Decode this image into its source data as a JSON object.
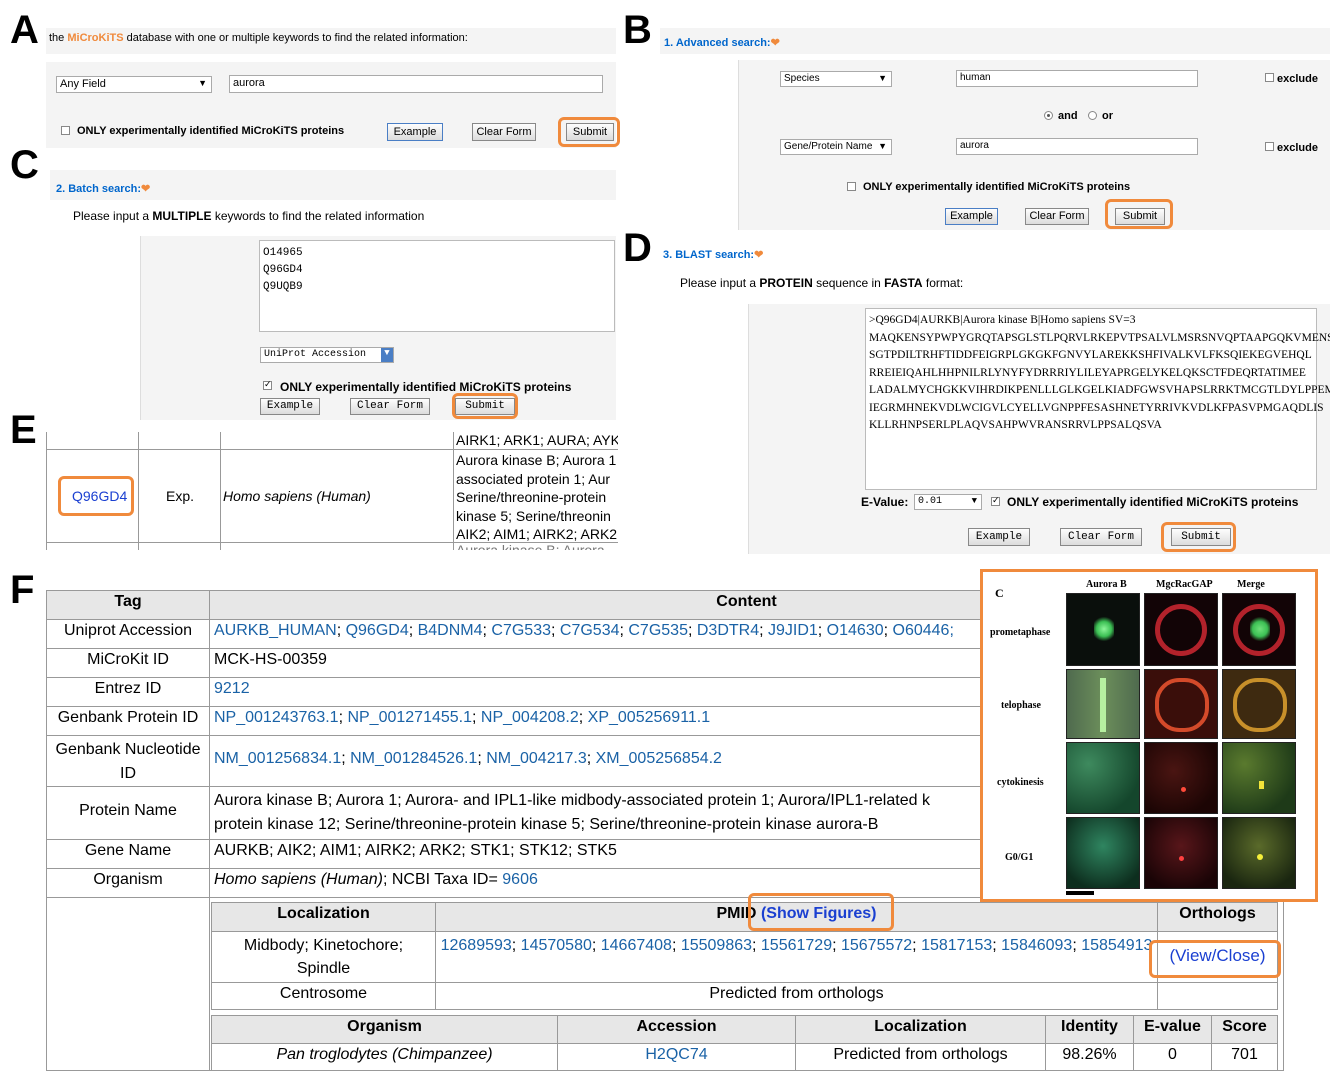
{
  "panel_labels": {
    "a": "A",
    "b": "B",
    "c": "C",
    "d": "D",
    "e": "E",
    "f": "F"
  },
  "A": {
    "intro_pre": "the ",
    "brand_mi": "MiCroKiTS",
    "intro_post": " database with one or multiple keywords to find the related information:",
    "field_select": "Any Field",
    "keyword_value": "aurora",
    "only_label": "ONLY experimentally identified MiCroKiTS proteins",
    "example": "Example",
    "clear": "Clear Form",
    "submit": "Submit"
  },
  "B": {
    "title": "1. Advanced search:",
    "row1_select": "Species",
    "row1_value": "human",
    "row1_exclude": "exclude",
    "and_label": "and",
    "or_label": "or",
    "row2_select": "Gene/Protein Name",
    "row2_value": "aurora",
    "row2_exclude": "exclude",
    "only_label": "ONLY experimentally identified MiCroKiTS proteins",
    "example": "Example",
    "clear": "Clear Form",
    "submit": "Submit"
  },
  "C": {
    "title": "2. Batch search:",
    "instr_pre": "Please input a ",
    "instr_bold": "MULTIPLE",
    "instr_post": " keywords to find the related information",
    "ids": [
      "O14965",
      "Q96GD4",
      "Q9UQB9"
    ],
    "type_select": "UniProt Accession",
    "only_label": "ONLY experimentally identified MiCroKiTS proteins",
    "example": "Example",
    "clear": "Clear Form",
    "submit": "Submit"
  },
  "D": {
    "title": "3. BLAST search:",
    "instr_pre": "Please input a ",
    "instr_bold1": "PROTEIN",
    "instr_mid": " sequence in ",
    "instr_bold2": "FASTA",
    "instr_post": " format:",
    "fasta": [
      ">Q96GD4|AURKB|Aurora kinase B|Homo sapiens SV=3",
      "MAQKENSYPWPYGRQTAPSGLSTLPQRVLRKEPVTPSALVLMSRSNVQPTAAPGQKVMENS",
      "SGTPDILTRHFTIDDFEIGRPLGKGKFGNVYLAREKKSHFIVALKVLFKSQIEKEGVEHQL",
      "RREIEIQAHLHHPNILRLYNYFYDRRRIYLILEYAPRGELYKELQKSCTFDEQRTATIMEE",
      "LADALMYCHGKKVIHRDIKPENLLLGLKGELKIADFGWSVHAPSLRRKTMCGTLDYLPPEM",
      "IEGRMHNEKVDLWCIGVLCYELLVGNPPFESASHNETYRRIVKVDLKFPASVPMGAQDLIS",
      "KLLRHNPSERLPLAQVSAHPWVRANSRRVLPPSALQSVA"
    ],
    "evalue_label": "E-Value:",
    "evalue": "0.01",
    "only_label": "ONLY experimentally identified MiCroKiTS proteins",
    "example": "Example",
    "clear": "Clear Form",
    "submit": "Submit"
  },
  "E": {
    "top_text": "AIRK1; ARK1; AURA; AYK",
    "accession": "Q96GD4",
    "evidence": "Exp.",
    "organism": "Homo sapiens (Human)",
    "names": [
      "Aurora kinase B; Aurora 1",
      "associated protein 1; Aur",
      "Serine/threonine-protein",
      "kinase 5; Serine/threonin",
      "AIK2; AIM1; AIRK2; ARK2"
    ],
    "bottom_text": "Aurora kinase B; Aurora"
  },
  "F": {
    "head_tag": "Tag",
    "head_content": "Content",
    "rows": [
      {
        "tag": "Uniprot Accession",
        "links": [
          "AURKB_HUMAN",
          "Q96GD4",
          "B4DNM4",
          "C7G533",
          "C7G534",
          "C7G535",
          "D3DTR4",
          "J9JID1",
          "O14630",
          "O60446;"
        ]
      },
      {
        "tag": "MiCroKit ID",
        "text": "MCK-HS-00359"
      },
      {
        "tag": "Entrez ID",
        "links": [
          "9212"
        ]
      },
      {
        "tag": "Genbank Protein ID",
        "links": [
          "NP_001243763.1",
          "NP_001271455.1",
          "NP_004208.2",
          "XP_005256911.1"
        ]
      },
      {
        "tag": "Genbank Nucleotide ID",
        "links": [
          "NM_001256834.1",
          "NM_001284526.1",
          "NM_004217.3",
          "XM_005256854.2"
        ]
      },
      {
        "tag": "Protein Name",
        "text": "Aurora kinase B; Aurora 1; Aurora- and IPL1-like midbody-associated protein 1; Aurora/IPL1-related k",
        "text2": "protein kinase 12; Serine/threonine-protein kinase 5; Serine/threonine-protein kinase aurora-B"
      },
      {
        "tag": "Gene Name",
        "text": "AURKB; AIK2; AIM1; AIRK2; ARK2; STK1; STK12; STK5"
      },
      {
        "tag": "Organism",
        "italic": "Homo sapiens (Human)",
        "text": "; NCBI Taxa ID= ",
        "link": "9606"
      }
    ],
    "loc_head": "Localization",
    "pmid_head": "PMID",
    "show_figures": "(Show Figures)",
    "orth_head": "Orthologs",
    "loc1": "Midbody; Kinetochore; Spindle",
    "pmids": [
      "12689593",
      "14570580",
      "14667408",
      "15509863",
      "15561729",
      "15675572",
      "15817153",
      "15846093",
      "15854913"
    ],
    "view_close": "(View/Close)",
    "loc2": "Centrosome",
    "loc2_text": "Predicted from orthologs",
    "orth_cols": [
      "Organism",
      "Accession",
      "Localization",
      "Identity",
      "E-value",
      "Score"
    ],
    "orth_row": [
      "Pan troglodytes (Chimpanzee)",
      "H2QC74",
      "Predicted from orthologs",
      "98.26%",
      "0",
      "701"
    ]
  },
  "figure": {
    "letter": "C",
    "col_heads": [
      "Aurora B",
      "MgcRacGAP",
      "Merge"
    ],
    "rows": [
      "prometaphase",
      "telophase",
      "cytokinesis",
      "G0/G1"
    ]
  },
  "colors": {
    "highlight": "#f08a3c",
    "link": "#1a62a6",
    "brand_orange": "#f08a3c"
  }
}
